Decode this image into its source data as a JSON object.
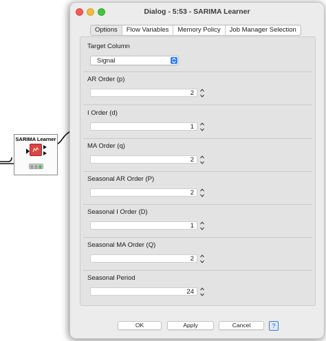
{
  "canvas": {
    "node": {
      "title": "SARIMA Learner",
      "icon": "sarima-node-icon",
      "status_lights": [
        "inactive",
        "inactive",
        "green"
      ]
    }
  },
  "dialog": {
    "title": "Dialog - 5:53 - SARIMA Learner",
    "window_controls": [
      "close-icon",
      "minimize-icon",
      "zoom-icon"
    ],
    "tabs": [
      {
        "label": "Options",
        "active": true
      },
      {
        "label": "Flow Variables",
        "active": false
      },
      {
        "label": "Memory Policy",
        "active": false
      },
      {
        "label": "Job Manager Selection",
        "active": false
      }
    ],
    "target_column": {
      "label": "Target Column",
      "value": "Signal"
    },
    "parameters": [
      {
        "label": "AR Order (p)",
        "value": "2"
      },
      {
        "label": "I Order (d)",
        "value": "1"
      },
      {
        "label": "MA Order (q)",
        "value": "2"
      },
      {
        "label": "Seasonal AR Order (P)",
        "value": "2"
      },
      {
        "label": "Seasonal I Order (D)",
        "value": "1"
      },
      {
        "label": "Seasonal MA Order (Q)",
        "value": "2"
      },
      {
        "label": "Seasonal Period",
        "value": "24"
      }
    ],
    "buttons": {
      "ok": "OK",
      "apply": "Apply",
      "cancel": "Cancel",
      "help": "?"
    }
  },
  "colors": {
    "accent": "#2d7cf6",
    "node_icon": "#d9454a",
    "status_green": "#3fbf4a"
  }
}
